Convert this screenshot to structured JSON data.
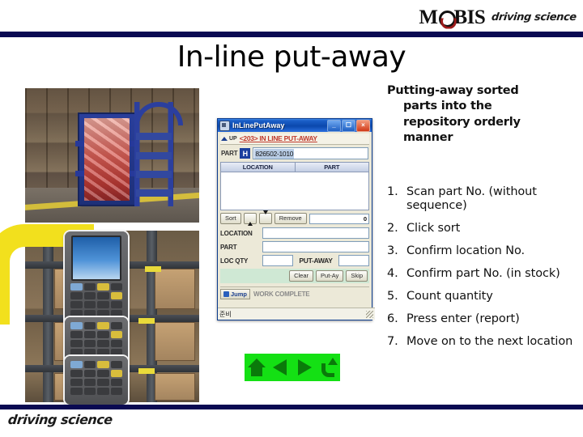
{
  "brand": {
    "logo_text_before": "M",
    "logo_o": "O",
    "logo_text_after": "BIS",
    "logo_tagline": "driving science",
    "footer_tagline": "driving science",
    "navy": "#0a0a52",
    "accent_red": "#9b1b1b"
  },
  "slide": {
    "title": "In-line put-away",
    "lead_line1": "Putting-away sorted",
    "lead_line2": "parts into the",
    "lead_line3": "repository orderly",
    "lead_line4": "manner",
    "steps": [
      {
        "num": "1.",
        "text": "Scan part No. (without sequence)"
      },
      {
        "num": "2.",
        "text": "Click sort"
      },
      {
        "num": "3.",
        "text": "Confirm location No."
      },
      {
        "num": "4.",
        "text": "Confirm part No. (in stock)"
      },
      {
        "num": "5.",
        "text": "Count quantity"
      },
      {
        "num": "6.",
        "text": "Press enter (report)"
      },
      {
        "num": "7.",
        "text": "Move on to the next location"
      }
    ]
  },
  "app_window": {
    "title": "InLinePutAway",
    "minimize_label": "_",
    "maximize_label": "☐",
    "close_label": "×",
    "up_label": "UP",
    "breadcrumb": "<203> IN LINE PUT-AWAY",
    "part_label": "PART",
    "part_prefix": "H",
    "part_value": "826502-1010",
    "grid": {
      "columns": [
        "LOCATION",
        "PART"
      ],
      "rows": []
    },
    "tools": {
      "sort_label": "Sort",
      "up_arrow": "▲",
      "down_arrow": "▼",
      "remove_label": "Remove",
      "count_value": "0"
    },
    "form": {
      "location_label": "LOCATION",
      "location_value": "",
      "part_label": "PART",
      "part_value": "",
      "loc_qty_label": "LOC QTY",
      "loc_qty_value": "",
      "putaway_label": "PUT-AWAY",
      "putaway_value": ""
    },
    "actions": {
      "clear_label": "Clear",
      "putay_label": "Put-Ay",
      "skip_label": "Skip"
    },
    "tabs": {
      "jump_label": "Jump",
      "work_complete_label": "WORK COMPLETE"
    },
    "statusbar_text": "준비"
  },
  "green_nav": {
    "home_icon": "home-icon",
    "left_icon": "arrow-left-icon",
    "right_icon": "arrow-right-icon",
    "return_icon": "return-arrow-icon",
    "background": "#14e014"
  },
  "photos": {
    "top_caption": "warehouse blue cart with sorted parts and step ladder",
    "bottom_caption": "handheld barcode scanner in front of warehouse racking"
  }
}
